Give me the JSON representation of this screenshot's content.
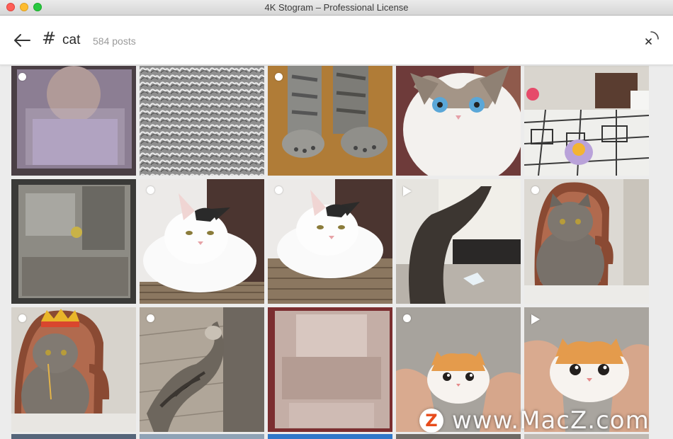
{
  "window": {
    "title": "4K Stogram – Professional License"
  },
  "header": {
    "hash_symbol": "#",
    "tag": "cat",
    "post_count": "584 posts"
  },
  "icons": {
    "back": "arrow-left-icon",
    "loading": "loading-spinner-icon",
    "photo_marker": "dot-icon",
    "video_marker": "play-icon"
  },
  "posts": [
    {
      "kind": "photo",
      "subject": "blurred person",
      "marker": "dot"
    },
    {
      "kind": "photo",
      "subject": "grey fur texture",
      "marker": "none"
    },
    {
      "kind": "photo",
      "subject": "tabby cat paws on wooden floor",
      "marker": "dot"
    },
    {
      "kind": "photo",
      "subject": "ragdoll cat with blue eyes",
      "marker": "none"
    },
    {
      "kind": "photo",
      "subject": "cat drawing on a desk",
      "marker": "none"
    },
    {
      "kind": "photo",
      "subject": "blurred image",
      "marker": "none"
    },
    {
      "kind": "photo",
      "subject": "white and black cat lying down",
      "marker": "dot"
    },
    {
      "kind": "photo",
      "subject": "white and black cat lying down",
      "marker": "dot"
    },
    {
      "kind": "video",
      "subject": "cat tail by a computer desk",
      "marker": "play"
    },
    {
      "kind": "photo",
      "subject": "grey British shorthair in a chair",
      "marker": "dot"
    },
    {
      "kind": "photo",
      "subject": "grey cat wearing a crown",
      "marker": "dot"
    },
    {
      "kind": "photo",
      "subject": "tabby cat sleeping on its back",
      "marker": "dot"
    },
    {
      "kind": "photo",
      "subject": "blurred image",
      "marker": "none"
    },
    {
      "kind": "photo",
      "subject": "cat figurine held in hand",
      "marker": "dot"
    },
    {
      "kind": "video",
      "subject": "cat figurine held in hand",
      "marker": "play"
    }
  ],
  "watermark": {
    "logo": "Z",
    "text": "www.MacZ.com"
  },
  "colors": {
    "traffic_close": "#fe5f57",
    "traffic_min": "#febc2e",
    "traffic_max": "#28c840",
    "header_bg": "#ffffff",
    "grid_bg": "#ececec"
  }
}
